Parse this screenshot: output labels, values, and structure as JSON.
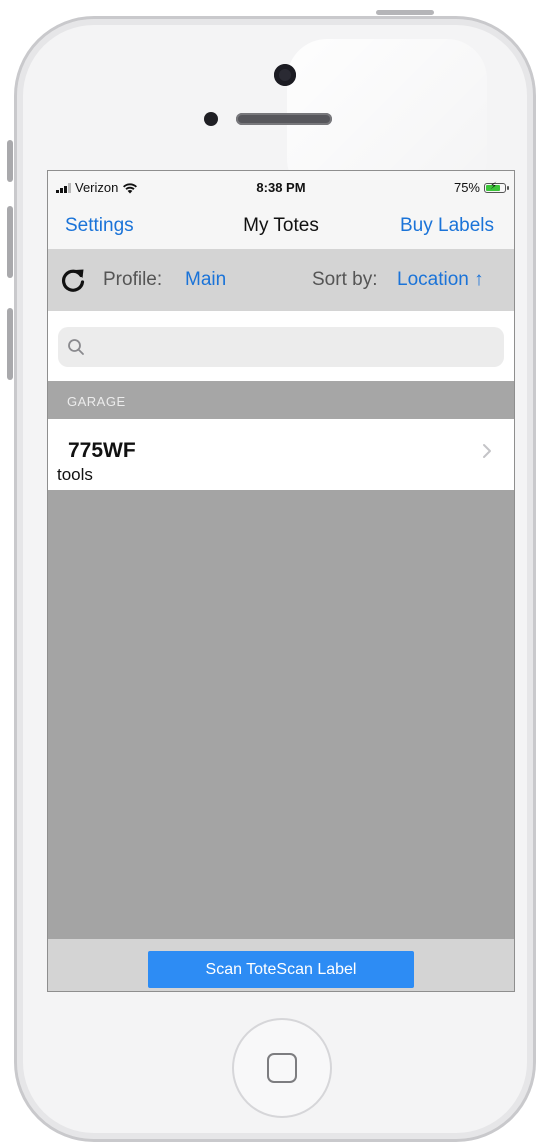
{
  "status_bar": {
    "carrier": "Verizon",
    "time": "8:38 PM",
    "battery_percent": "75%",
    "signal_icon": "signal-bars-icon",
    "wifi_icon": "wifi-icon",
    "battery_icon": "battery-charging-icon"
  },
  "nav": {
    "left_label": "Settings",
    "title": "My Totes",
    "right_label": "Buy Labels"
  },
  "toolbar": {
    "refresh_icon": "refresh-icon",
    "profile_label": "Profile:",
    "profile_value": "Main",
    "sort_label": "Sort by:",
    "sort_value": "Location ↑"
  },
  "search": {
    "placeholder": "",
    "value": "",
    "icon": "search-icon"
  },
  "sections": [
    {
      "title": "GARAGE",
      "items": [
        {
          "id": "775WF",
          "description": "tools"
        }
      ]
    }
  ],
  "bottom": {
    "scan_label": "Scan ToteScan Label"
  },
  "colors": {
    "accent": "#1a73d8",
    "button": "#2d8cf4",
    "list_background": "#a4a4a4"
  }
}
